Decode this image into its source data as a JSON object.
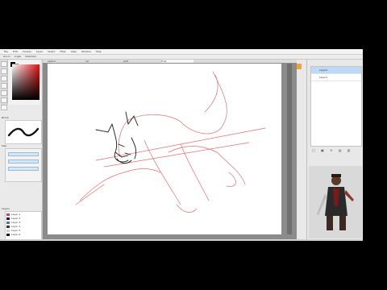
{
  "app": {
    "menu_items": [
      "File",
      "Edit",
      "Canvas",
      "Layer",
      "Select",
      "Filter",
      "View",
      "Window",
      "Help"
    ],
    "toolbar_items": [
      "Zoom",
      "Angle",
      "Stabilizer"
    ]
  },
  "canvas": {
    "tabs": [
      "sketch",
      "ref",
      "wolf",
      "final"
    ],
    "active_tab": 3
  },
  "left_panel": {
    "brush_title": "Brush",
    "slider_title": "Size",
    "swatch_title": "Layers",
    "swatches": [
      {
        "label": "Layer 1",
        "color": "#d23a8c"
      },
      {
        "label": "Layer 2",
        "color": "#1a1a1a"
      },
      {
        "label": "Layer 3",
        "color": "#4a6bd1"
      },
      {
        "label": "Layer 4",
        "color": "#333333"
      },
      {
        "label": "Layer 5",
        "color": "#b8d6f0"
      },
      {
        "label": "Layer 6",
        "color": "#1a1a1a"
      }
    ]
  },
  "right_panel": {
    "layers": [
      {
        "label": "Layer2",
        "selected": true
      },
      {
        "label": "Layer1",
        "selected": false
      }
    ],
    "layer_icons": "▢ ▣ ✕ ▤ ▥"
  },
  "colors": {
    "sketch_red": "#e07070",
    "sketch_black": "#1a1a1a",
    "accent": "#bcd9f5"
  }
}
